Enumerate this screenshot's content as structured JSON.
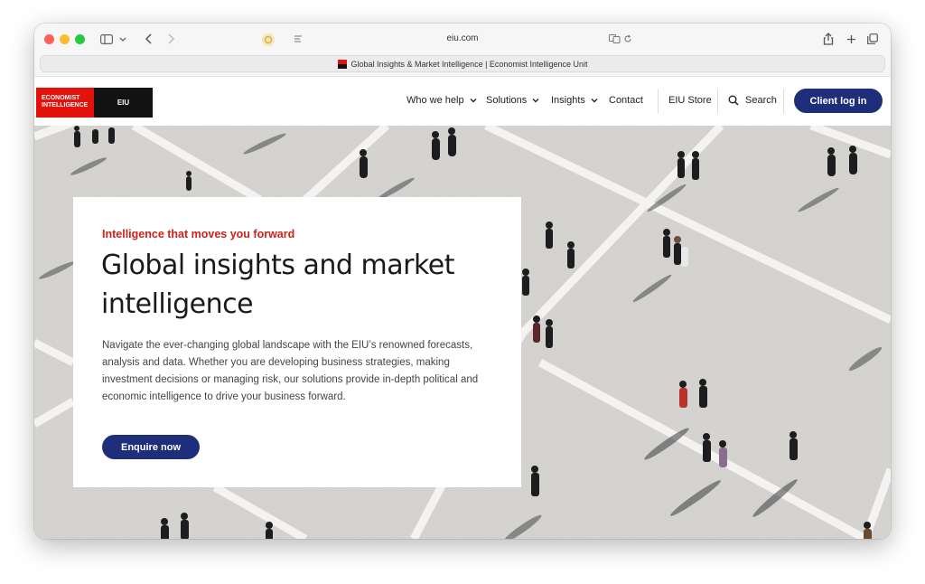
{
  "browser": {
    "url": "eiu.com",
    "tab_title": "Global Insights & Market Intelligence | Economist Intelligence Unit"
  },
  "site": {
    "logo": {
      "line1": "ECONOMIST",
      "line2": "INTELLIGENCE",
      "short": "EIU"
    },
    "nav": {
      "who_we_help": "Who we help",
      "solutions": "Solutions",
      "insights": "Insights",
      "contact": "Contact",
      "store": "EIU Store",
      "search": "Search",
      "login": "Client log in"
    },
    "colors": {
      "brand_red": "#e3120b",
      "brand_navy": "#1f2e7a",
      "eyebrow_red": "#d0201a"
    }
  },
  "hero": {
    "eyebrow": "Intelligence that moves you forward",
    "headline": "Global insights and market intelligence",
    "body": "Navigate the ever-changing global landscape with the EIU’s renowned forecasts, analysis and data. Whether you are developing business strategies, making investment decisions or managing risk, our solutions provide in-depth political and economic intelligence to drive your business forward.",
    "cta": "Enquire now"
  },
  "icons": [
    "sidebar-icon",
    "chevron-down-icon",
    "back-icon",
    "forward-icon",
    "extension-icon",
    "reader-icon",
    "translate-icon",
    "reload-icon",
    "share-icon",
    "plus-icon",
    "tabs-icon",
    "search-icon"
  ]
}
